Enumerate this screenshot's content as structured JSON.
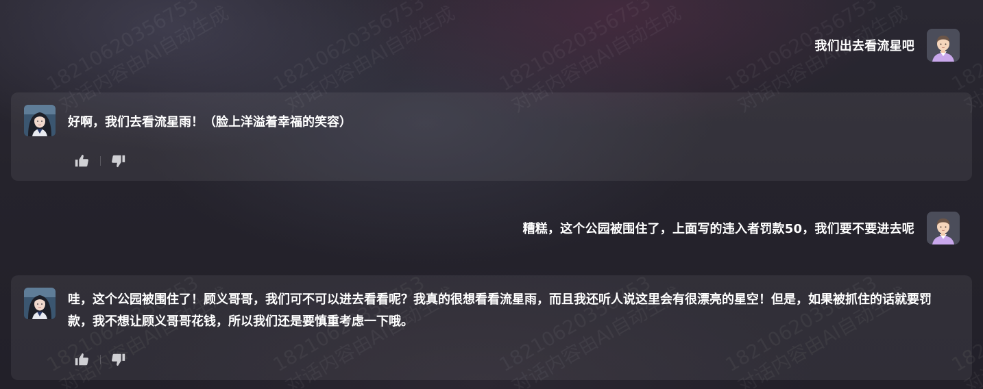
{
  "watermark": {
    "line1": "18210620356753",
    "line2": "对话内容由AI自动生成"
  },
  "messages": [
    {
      "role": "user",
      "text": "我们出去看流星吧",
      "avatar_icon": "user-avatar-icon"
    },
    {
      "role": "assistant",
      "text": "好啊，我们去看流星雨！（脸上洋溢着幸福的笑容）",
      "avatar_icon": "character-avatar-icon"
    },
    {
      "role": "user",
      "text": "糟糕，这个公园被围住了，上面写的违入者罚款50，我们要不要进去呢",
      "avatar_icon": "user-avatar-icon"
    },
    {
      "role": "assistant",
      "text": "哇，这个公园被围住了！顾义哥哥，我们可不可以进去看看呢？我真的很想看看流星雨，而且我还听人说这里会有很漂亮的星空！但是，如果被抓住的话就要罚款，我不想让顾义哥哥花钱，所以我们还是要慎重考虑一下哦。",
      "avatar_icon": "character-avatar-icon"
    }
  ],
  "actions": {
    "like_icon": "thumbs-up-icon",
    "dislike_icon": "thumbs-down-icon"
  },
  "colors": {
    "background": "#25232c",
    "card": "#35343d",
    "text": "#ffffff",
    "icon": "#d0d0d4"
  }
}
